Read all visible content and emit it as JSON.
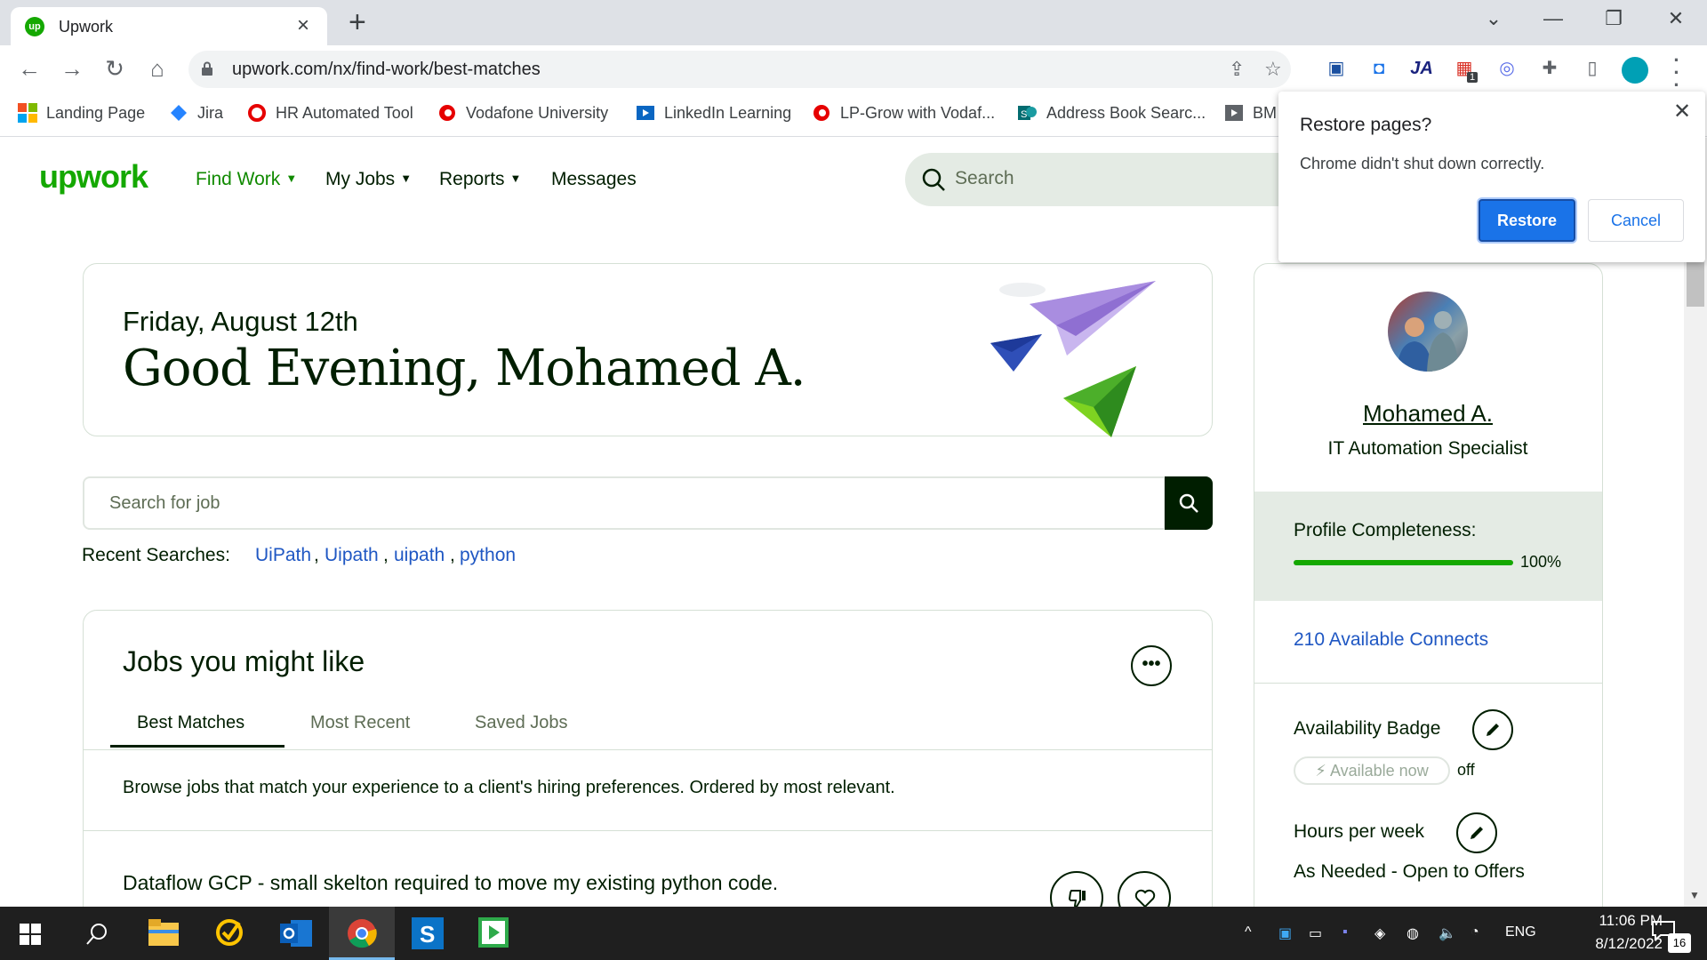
{
  "browser": {
    "tab_title": "Upwork",
    "url": "upwork.com/nx/find-work/best-matches",
    "bookmarks": [
      {
        "label": "Landing Page"
      },
      {
        "label": "Jira"
      },
      {
        "label": "HR Automated Tool"
      },
      {
        "label": "Vodafone University"
      },
      {
        "label": "LinkedIn Learning"
      },
      {
        "label": "LP-Grow with Vodaf..."
      },
      {
        "label": "Address Book Searc..."
      },
      {
        "label": "BM"
      }
    ],
    "extension_badge": "1",
    "extension_ja": "JA"
  },
  "upwork_nav": {
    "logo": "upwork",
    "find_work": "Find Work",
    "my_jobs": "My Jobs",
    "reports": "Reports",
    "messages": "Messages",
    "search_placeholder": "Search"
  },
  "greeting": {
    "date": "Friday, August 12th",
    "message": "Good Evening, Mohamed A."
  },
  "job_search": {
    "placeholder": "Search for job",
    "recent_label": "Recent Searches:",
    "recent": [
      "UiPath",
      "Uipath",
      "uipath",
      "python"
    ]
  },
  "jobs_section": {
    "title": "Jobs you might like",
    "tabs": [
      "Best Matches",
      "Most Recent",
      "Saved Jobs"
    ],
    "active_tab": "Best Matches",
    "description": "Browse jobs that match your experience to a client's hiring preferences. Ordered by most relevant.",
    "first_job_title": "Dataflow GCP - small skelton required to move my existing python code."
  },
  "profile": {
    "name": "Mohamed A.",
    "role": "IT Automation Specialist",
    "completeness_label": "Profile Completeness:",
    "completeness_value": "100%",
    "completeness_fraction": 1.0,
    "connects": "210 Available Connects",
    "availability_label": "Availability Badge",
    "availability_pill": "Available now",
    "availability_state": "off",
    "hours_label": "Hours per week",
    "hours_value": "As Needed - Open to Offers"
  },
  "dialog": {
    "title": "Restore pages?",
    "message": "Chrome didn't shut down correctly.",
    "restore": "Restore",
    "cancel": "Cancel"
  },
  "taskbar": {
    "language": "ENG",
    "time": "11:06 PM",
    "date": "8/12/2022",
    "notifications": "16"
  },
  "colors": {
    "upwork_green": "#14a800",
    "link_blue": "#1f57c3",
    "chrome_blue": "#1a73e8"
  }
}
